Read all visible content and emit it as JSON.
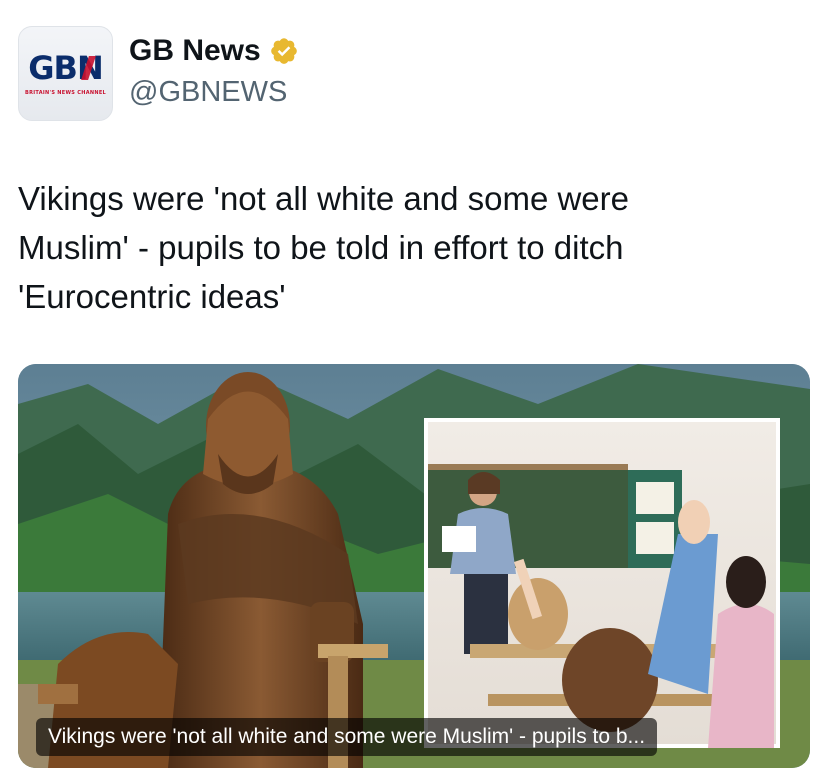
{
  "account": {
    "display_name": "GB News",
    "handle": "@GBNEWS",
    "verified": true,
    "verified_color": "#e8b830",
    "avatar": {
      "logo_text_left": "GB",
      "logo_text_right": "N",
      "logo_subtext": "BRITAIN'S NEWS CHANNEL",
      "brand_navy": "#0b2d6b",
      "brand_red": "#c8102e"
    }
  },
  "post": {
    "text": "Vikings were 'not all white and some were\nMuslim' - pupils to be told in effort to ditch\n'Eurocentric ideas'"
  },
  "card": {
    "image_subjects": [
      "wooden-viking-statue",
      "mountain-fjord",
      "classroom-inset"
    ],
    "caption": "Vikings were 'not all white and some were Muslim' - pupils to b..."
  }
}
